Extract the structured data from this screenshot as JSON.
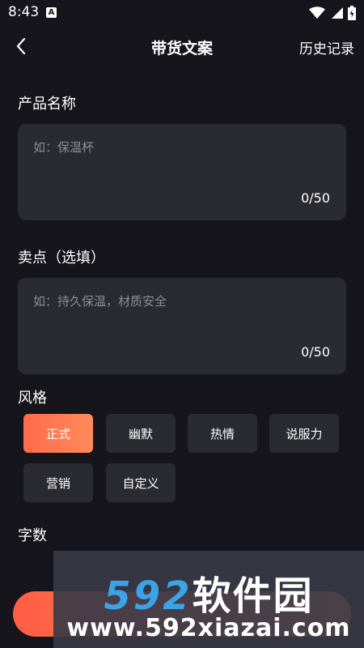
{
  "status_bar": {
    "time": "8:43",
    "notification_icon": "A"
  },
  "header": {
    "back_icon": "chevron-left-icon",
    "title": "带货文案",
    "history_label": "历史记录"
  },
  "product_name": {
    "label": "产品名称",
    "placeholder": "如：保温杯",
    "counter": "0/50"
  },
  "selling_points": {
    "label": "卖点（选填）",
    "placeholder": "如：持久保温，材质安全",
    "counter": "0/50"
  },
  "style": {
    "label": "风格",
    "options": [
      "正式",
      "幽默",
      "热情",
      "说服力",
      "营销",
      "自定义"
    ],
    "selected": "正式"
  },
  "word_count": {
    "label": "字数"
  },
  "watermark": {
    "logo_number": "592",
    "logo_text": "软件园",
    "url": "www.592xiazai.com"
  },
  "colors": {
    "accent": "#ff6b4a",
    "background": "#15151b",
    "card": "#2a2a31",
    "watermark_blue": "#3ba3e6"
  }
}
